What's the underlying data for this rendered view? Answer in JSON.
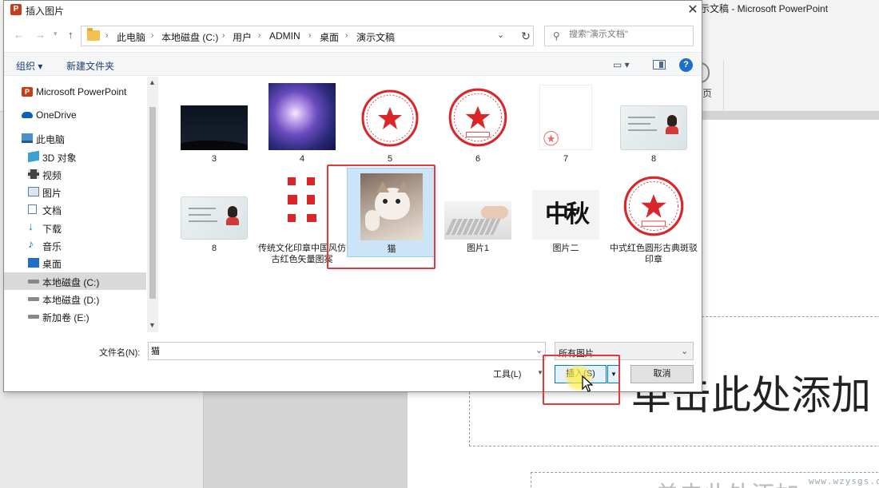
{
  "ppt": {
    "window_title": "示文稿 - Microsoft PowerPoint",
    "ribbon_fragment": "页",
    "slide_title_text": "单击此处添加",
    "slide_subtitle_text": "单击此处添加",
    "watermark": "www.wzysgs.com"
  },
  "dialog": {
    "title": "插入图片",
    "app_icon_letter": "P",
    "close_icon": "close-icon",
    "breadcrumbs": [
      "此电脑",
      "本地磁盘 (C:)",
      "用户",
      "ADMIN",
      "桌面",
      "演示文稿"
    ],
    "search_placeholder": "搜索\"演示文档\"",
    "commands": {
      "organize": "组织 ▾",
      "new_folder": "新建文件夹",
      "help": "?"
    },
    "nav_items": [
      {
        "label": "Microsoft PowerPoint",
        "icon": "powerpoint-icon"
      },
      {
        "label": "OneDrive",
        "icon": "cloud-icon"
      },
      {
        "label": "此电脑",
        "icon": "computer-icon"
      },
      {
        "label": "3D 对象",
        "icon": "cube-icon"
      },
      {
        "label": "视频",
        "icon": "video-icon"
      },
      {
        "label": "图片",
        "icon": "picture-icon"
      },
      {
        "label": "文档",
        "icon": "document-icon"
      },
      {
        "label": "下载",
        "icon": "download-icon"
      },
      {
        "label": "音乐",
        "icon": "music-icon"
      },
      {
        "label": "桌面",
        "icon": "desktop-icon"
      },
      {
        "label": "本地磁盘 (C:)",
        "icon": "drive-icon",
        "selected": true
      },
      {
        "label": "本地磁盘 (D:)",
        "icon": "drive-icon"
      },
      {
        "label": "新加卷 (E:)",
        "icon": "drive-icon"
      }
    ],
    "files": [
      {
        "label": "3",
        "kind": "night-sky"
      },
      {
        "label": "4",
        "kind": "nebula"
      },
      {
        "label": "5",
        "kind": "round-seal"
      },
      {
        "label": "6",
        "kind": "company-seal"
      },
      {
        "label": "7",
        "kind": "document-seal"
      },
      {
        "label": "8",
        "kind": "id-card"
      },
      {
        "label": "8",
        "kind": "id-card"
      },
      {
        "label": "传统文化印章中国风仿古红色矢量图案",
        "kind": "seal-pattern"
      },
      {
        "label": "猫",
        "kind": "cat",
        "selected": true
      },
      {
        "label": "图片1",
        "kind": "keyboard"
      },
      {
        "label": "图片二",
        "kind": "calligraphy"
      },
      {
        "label": "中式红色圆形古典斑驳印章",
        "kind": "company-seal"
      }
    ],
    "filename_label": "文件名(N):",
    "filename_value": "猫",
    "filetype_value": "所有图片",
    "tools_label": "工具(L)",
    "insert_label": "插入(S)",
    "cancel_label": "取消"
  }
}
